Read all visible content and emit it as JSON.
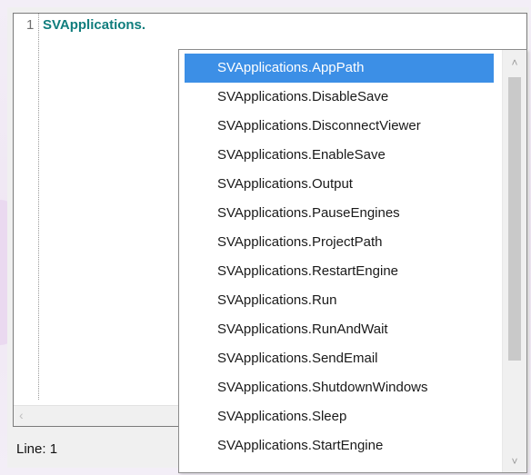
{
  "editor": {
    "line_number": "1",
    "code_text": "SVApplications."
  },
  "status": {
    "line_label": "Line: 1"
  },
  "autocomplete": {
    "items": [
      "SVApplications.AppPath",
      "SVApplications.DisableSave",
      "SVApplications.DisconnectViewer",
      "SVApplications.EnableSave",
      "SVApplications.Output",
      "SVApplications.PauseEngines",
      "SVApplications.ProjectPath",
      "SVApplications.RestartEngine",
      "SVApplications.Run",
      "SVApplications.RunAndWait",
      "SVApplications.SendEmail",
      "SVApplications.ShutdownWindows",
      "SVApplications.Sleep",
      "SVApplications.StartEngine"
    ],
    "selected_index": 0
  },
  "icons": {
    "scroll_up": "chevron-up-icon",
    "scroll_down": "chevron-down-icon",
    "scroll_left": "chevron-left-icon"
  },
  "colors": {
    "selection": "#3c8fe6",
    "code_text": "#0f7d7d"
  }
}
